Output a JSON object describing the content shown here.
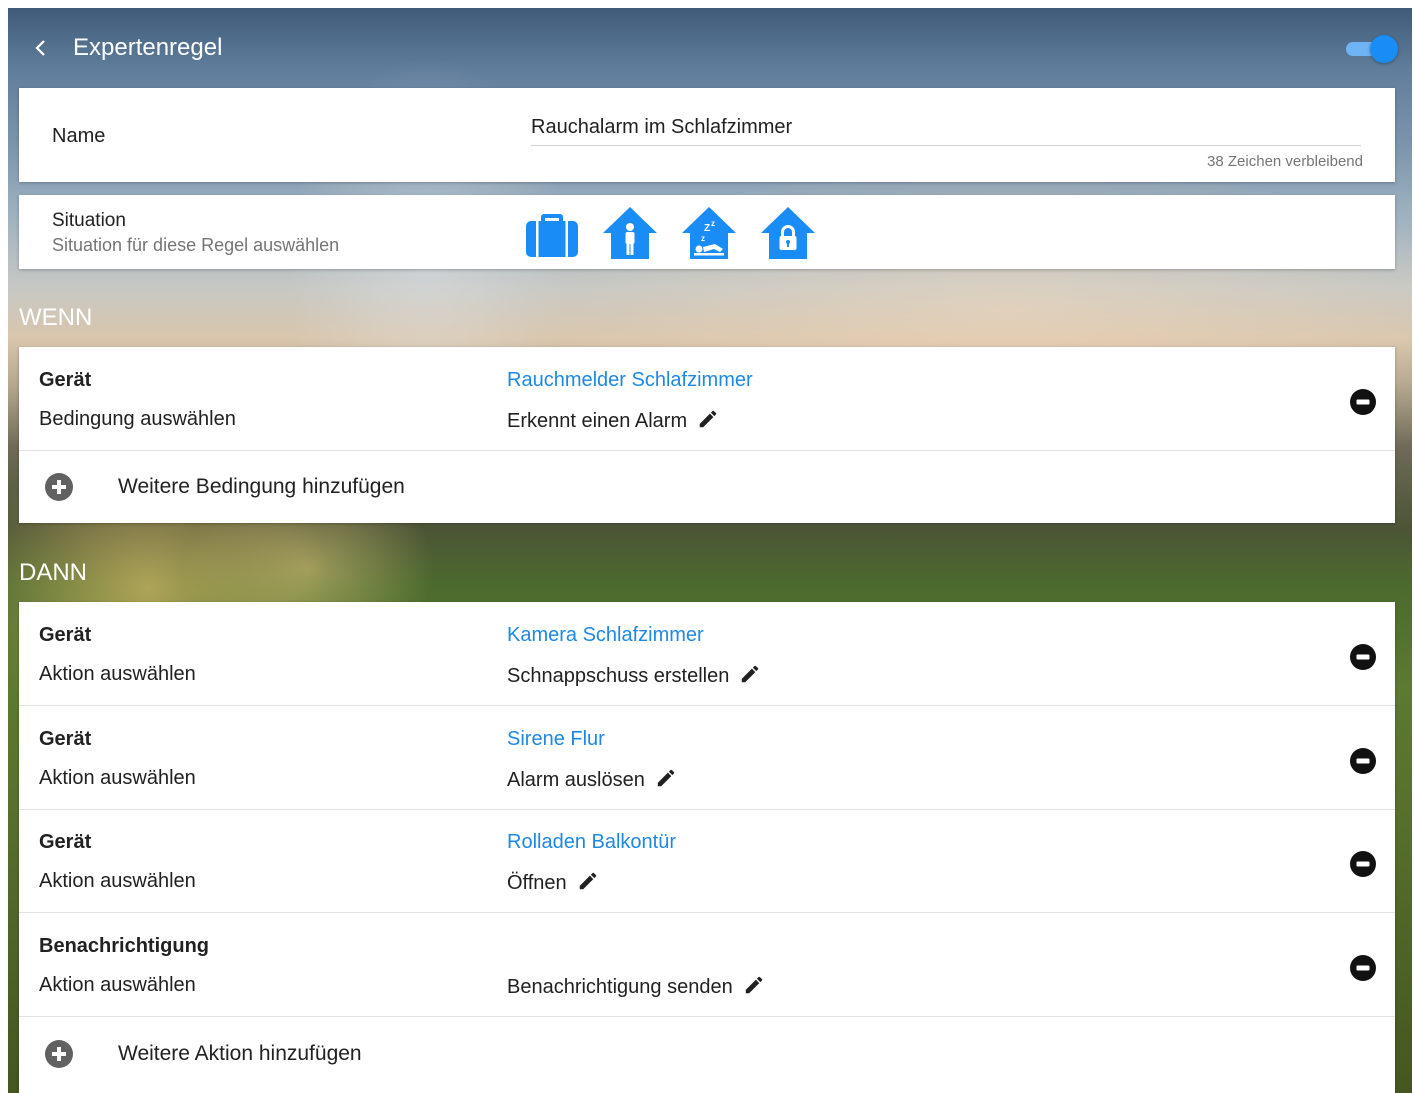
{
  "header": {
    "title": "Expertenregel",
    "back_icon": "chevron-left-icon",
    "rule_enabled": true
  },
  "name_card": {
    "label": "Name",
    "value": "Rauchalarm im Schlafzimmer",
    "counter": "38 Zeichen verbleibend"
  },
  "situation_card": {
    "label": "Situation",
    "sublabel": "Situation für diese Regel auswählen",
    "icons": [
      "suitcase-icon",
      "person-home-icon",
      "sleep-home-icon",
      "lock-home-icon"
    ],
    "icon_color": "#1a8cf5"
  },
  "wenn": {
    "heading": "WENN",
    "conditions": [
      {
        "type": "Gerät",
        "description": "Bedingung auswählen",
        "device": "Rauchmelder Schlafzimmer",
        "value": "Erkennt einen Alarm"
      }
    ],
    "add_label": "Weitere Bedingung hinzufügen"
  },
  "dann": {
    "heading": "DANN",
    "actions": [
      {
        "type": "Gerät",
        "description": "Aktion auswählen",
        "device": "Kamera Schlafzimmer",
        "value": "Schnappschuss erstellen"
      },
      {
        "type": "Gerät",
        "description": "Aktion auswählen",
        "device": "Sirene Flur",
        "value": "Alarm auslösen"
      },
      {
        "type": "Gerät",
        "description": "Aktion auswählen",
        "device": "Rolladen Balkontür",
        "value": "Öffnen"
      },
      {
        "type": "Benachrichtigung",
        "description": "Aktion auswählen",
        "device": "",
        "value": "Benachrichtigung senden"
      }
    ],
    "add_label": "Weitere Aktion hinzufügen"
  },
  "colors": {
    "accent": "#1e88e5",
    "toggle": "#1a8cf5",
    "text": "#212121",
    "secondary_text": "#757575"
  }
}
